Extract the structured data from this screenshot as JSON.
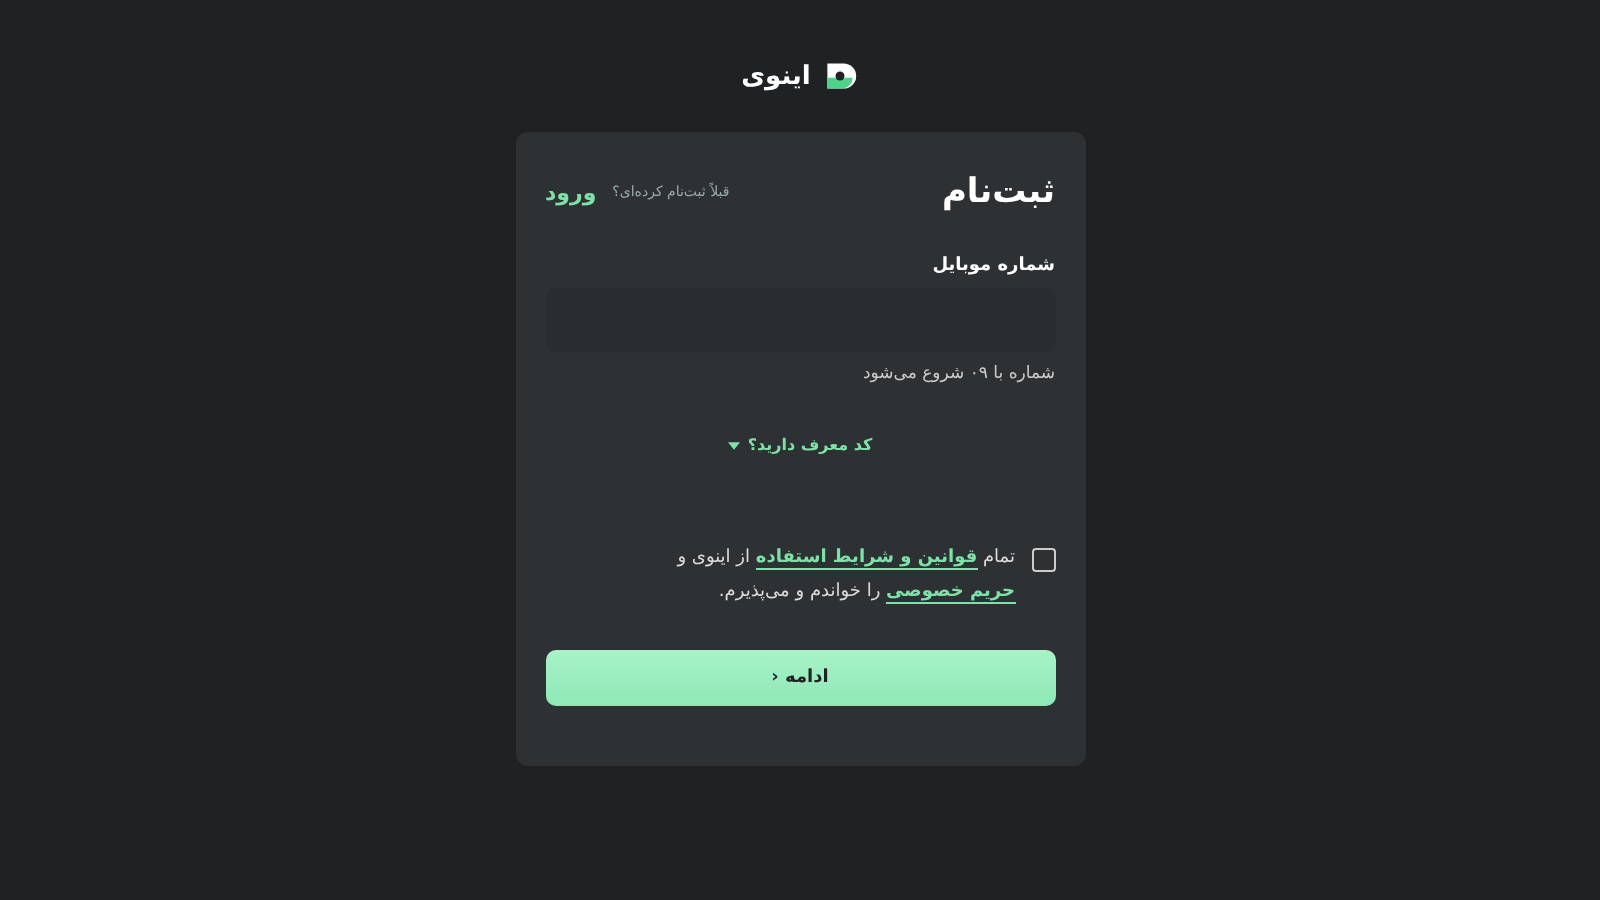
{
  "brand": {
    "name": "اینوی"
  },
  "card": {
    "title": "ثبت‌نام",
    "login_prompt": "قبلاً ثبت‌نام کرده‌ای؟",
    "login_link": "ورود"
  },
  "mobile_field": {
    "label": "شماره موبایل",
    "hint": "شماره با ۰۹ شروع می‌شود"
  },
  "referral": {
    "label": "کد معرف دارید؟",
    "expanded": false
  },
  "terms": {
    "checked": false,
    "before": "تمام",
    "link_terms": "قوانین و شرایط استفاده",
    "middle": "از اینوی و",
    "link_privacy": "حریم خصوصی",
    "after": "را خواندم و می‌پذیرم."
  },
  "submit": {
    "label": "ادامه",
    "icon": "‹"
  }
}
